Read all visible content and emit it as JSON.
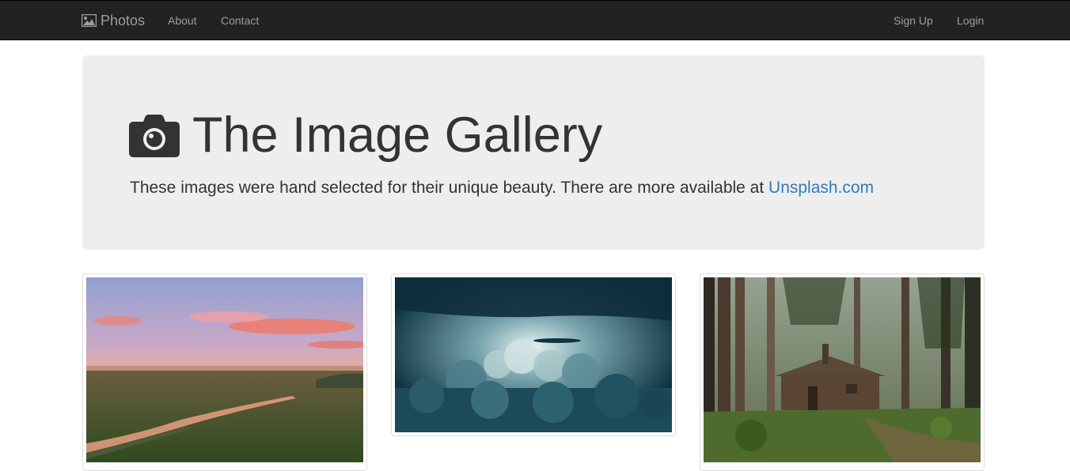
{
  "navbar": {
    "brand_label": "Photos",
    "brand_icon": "picture-icon",
    "links": [
      "About",
      "Contact"
    ],
    "right_links": [
      "Sign Up",
      "Login"
    ],
    "background": "#222222",
    "link_color": "#9d9d9d"
  },
  "jumbotron": {
    "title": "The Image Gallery",
    "title_icon": "camera-icon",
    "text": "These images were hand selected for their unique beauty. There are more available at ",
    "link_text": "Unsplash.com",
    "link_color": "#337ab7",
    "background": "#eeeeee"
  },
  "thumbnails": [
    {
      "name": "sunset-meadow-photo"
    },
    {
      "name": "storm-clouds-photo"
    },
    {
      "name": "forest-cabin-photo"
    }
  ]
}
